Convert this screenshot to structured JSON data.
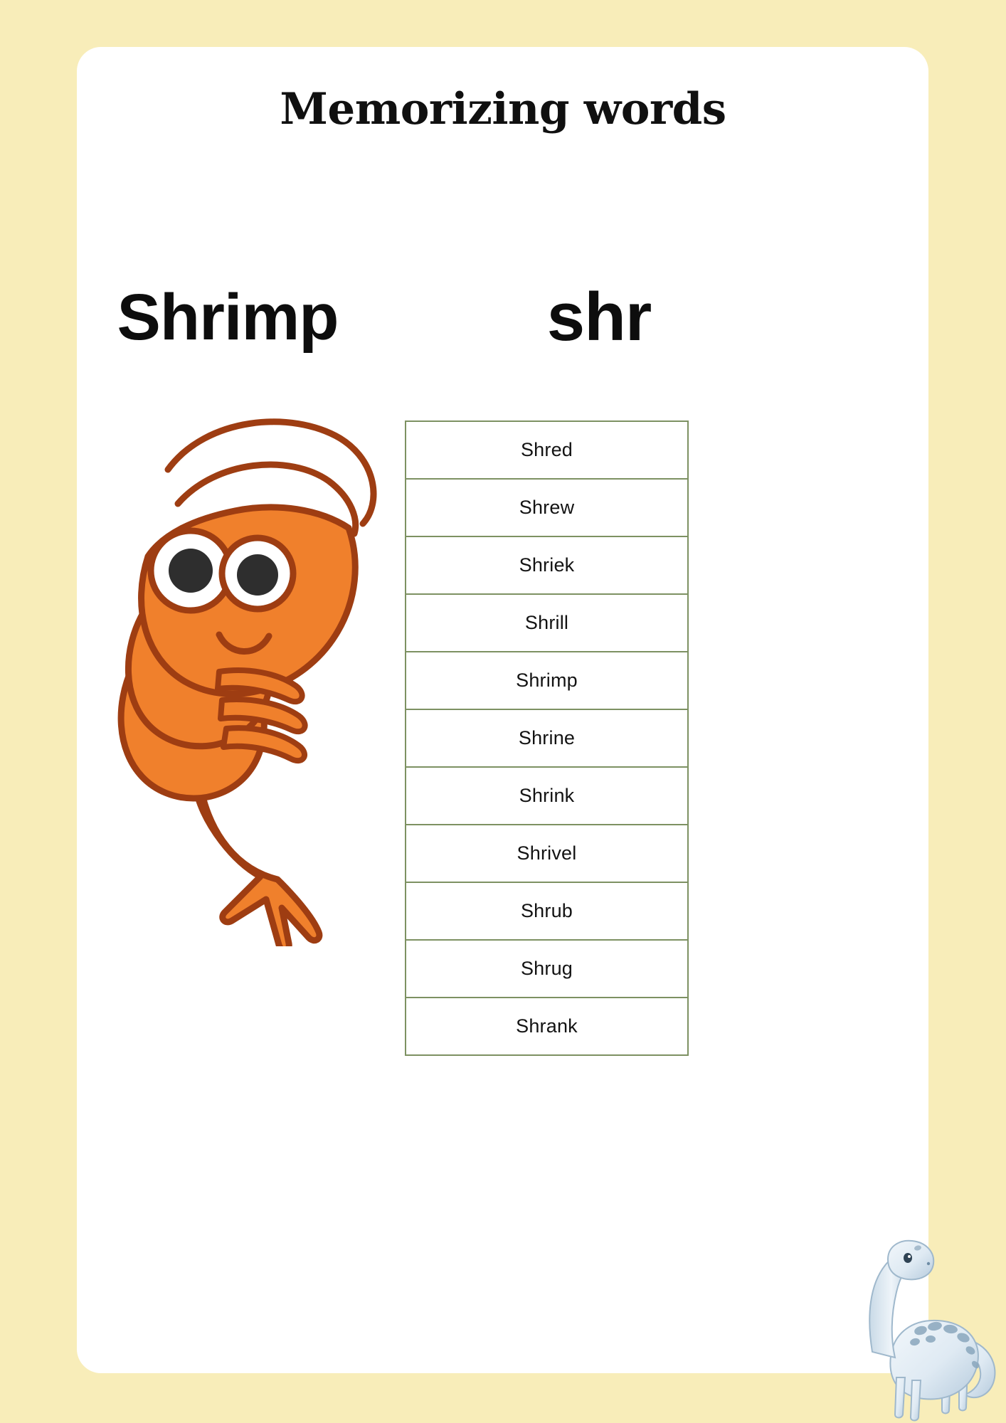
{
  "page": {
    "background_color": "#f8edb9",
    "card_color": "#ffffff"
  },
  "header": {
    "title": "Memorizing words"
  },
  "feature": {
    "word_heading": "Shrimp",
    "blend_heading": "shr"
  },
  "illustrations": {
    "shrimp": {
      "name": "shrimp-illustration",
      "body_color": "#f0802c",
      "outline_color": "#9e3d12",
      "eye_white": "#ffffff",
      "pupil_color": "#2e2e2e"
    },
    "dinosaur": {
      "name": "dinosaur-sticker",
      "body_color": "#e8f0f6",
      "shade_color": "#a9c0d3",
      "spot_color": "#6e8ca5"
    }
  },
  "word_table": {
    "border_color": "#7d9162",
    "rows": [
      "Shred",
      "Shrew",
      "Shriek",
      "Shrill",
      "Shrimp",
      "Shrine",
      "Shrink",
      "Shrivel",
      "Shrub",
      "Shrug",
      "Shrank"
    ]
  }
}
